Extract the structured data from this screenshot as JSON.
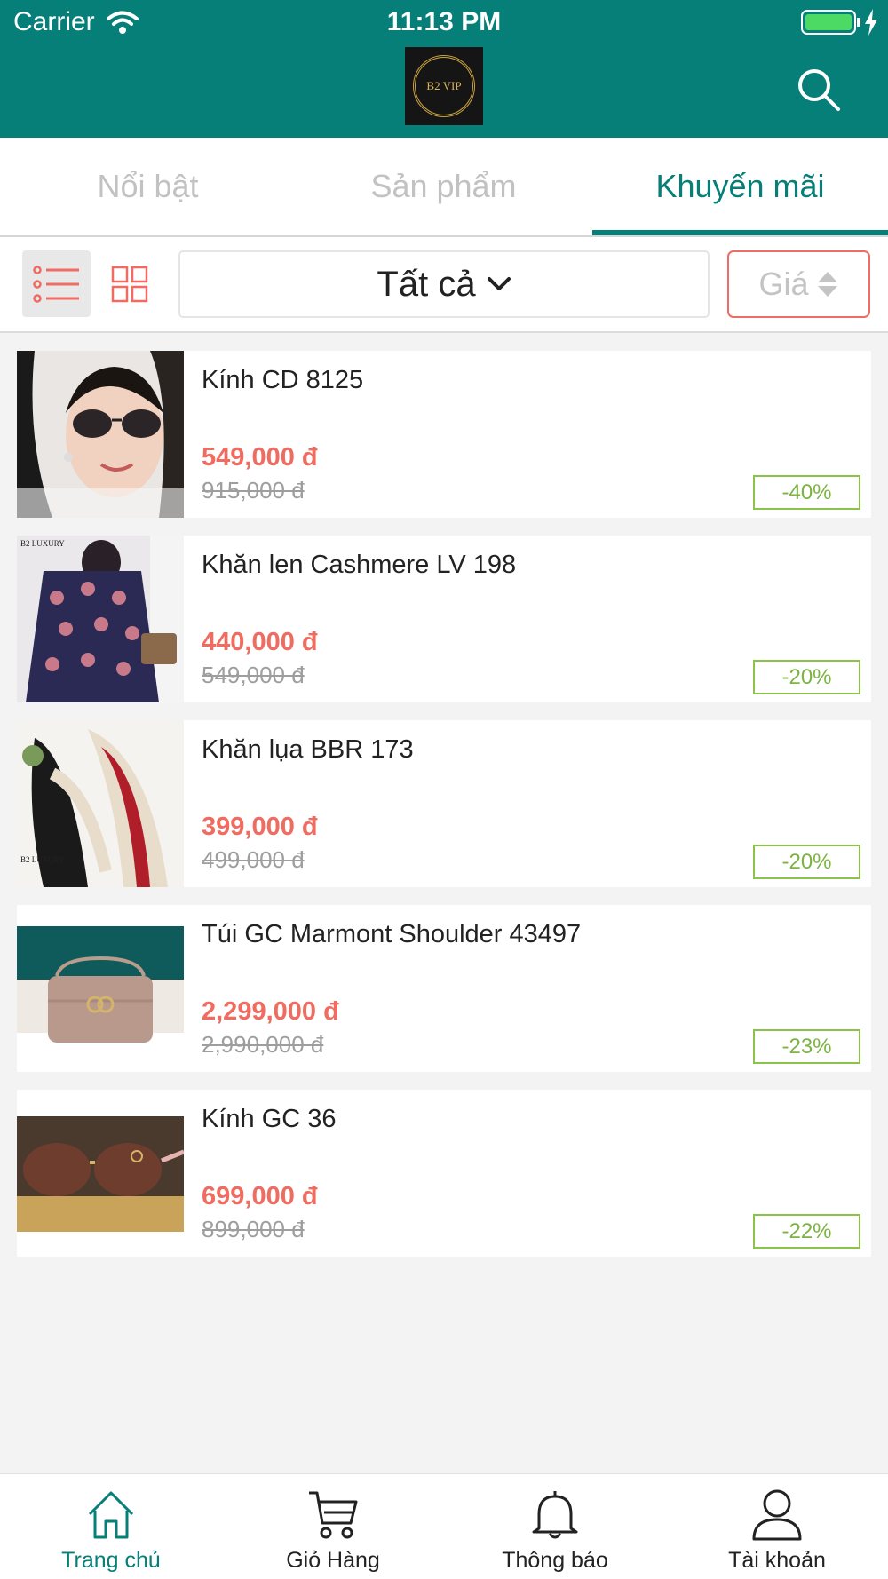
{
  "status_bar": {
    "carrier": "Carrier",
    "time": "11:13 PM"
  },
  "header": {
    "logo_text": "B2 VIP",
    "search_icon": "search-icon"
  },
  "tabs": [
    {
      "label": "Nổi bật",
      "active": false
    },
    {
      "label": "Sản phẩm",
      "active": false
    },
    {
      "label": "Khuyến mãi",
      "active": true
    }
  ],
  "filter": {
    "category": "Tất cả",
    "sort_label": "Giá",
    "view_mode": "list"
  },
  "products": [
    {
      "name": "Kính CD 8125",
      "price": "549,000 đ",
      "old_price": "915,000 đ",
      "discount": "-40%"
    },
    {
      "name": "Khăn len Cashmere LV 198",
      "price": "440,000 đ",
      "old_price": "549,000 đ",
      "discount": "-20%"
    },
    {
      "name": "Khăn lụa BBR 173",
      "price": "399,000 đ",
      "old_price": "499,000 đ",
      "discount": "-20%"
    },
    {
      "name": "Túi GC Marmont Shoulder 43497",
      "price": "2,299,000 đ",
      "old_price": "2,990,000 đ",
      "discount": "-23%"
    },
    {
      "name": "Kính GC 36",
      "price": "699,000 đ",
      "old_price": "899,000 đ",
      "discount": "-22%"
    }
  ],
  "bottom_nav": [
    {
      "label": "Trang chủ",
      "icon": "home-icon",
      "active": true
    },
    {
      "label": "Giỏ Hàng",
      "icon": "cart-icon",
      "active": false
    },
    {
      "label": "Thông báo",
      "icon": "bell-icon",
      "active": false
    },
    {
      "label": "Tài khoản",
      "icon": "user-icon",
      "active": false
    }
  ],
  "colors": {
    "primary": "#057f78",
    "price": "#f06b60",
    "discount": "#8bc34a",
    "sort_border": "#ef6b63"
  }
}
